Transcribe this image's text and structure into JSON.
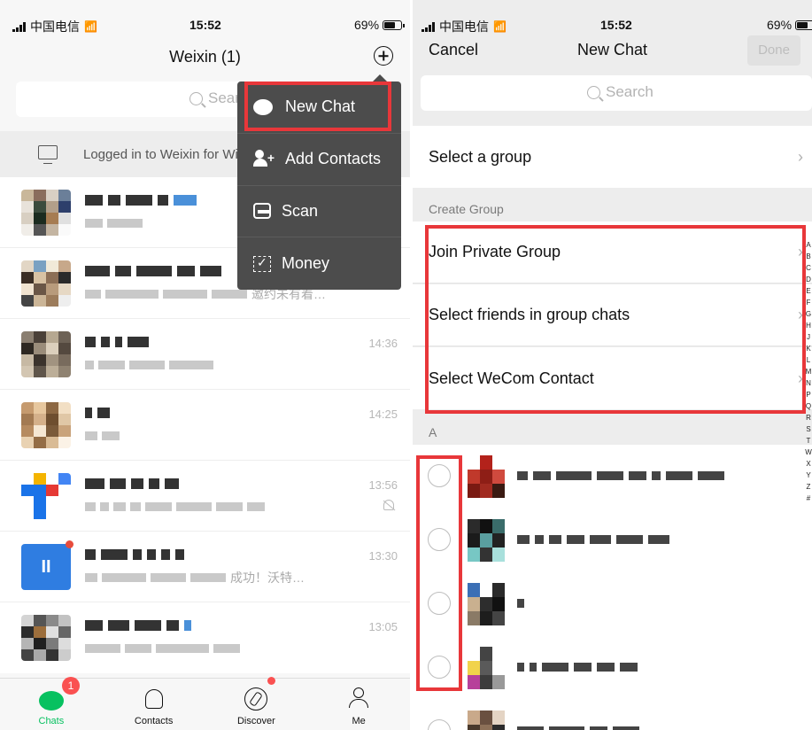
{
  "left": {
    "status": {
      "carrier": "中国电信",
      "time": "15:52",
      "battery": "69%"
    },
    "header": {
      "title": "Weixin (1)"
    },
    "search": {
      "placeholder": "Search"
    },
    "logged_in": "Logged in to Weixin for Windows",
    "chats": [
      {
        "time": ""
      },
      {
        "time": "",
        "preview_tail": "邀约未有着…"
      },
      {
        "time": "14:36"
      },
      {
        "time": "14:25"
      },
      {
        "time": "13:56"
      },
      {
        "time": "13:30",
        "preview_tail": "成功！沃特…"
      },
      {
        "time": "13:05"
      }
    ],
    "menu": [
      {
        "label": "New Chat",
        "icon": "chat-bubble-icon"
      },
      {
        "label": "Add Contacts",
        "icon": "add-contact-icon"
      },
      {
        "label": "Scan",
        "icon": "scan-icon"
      },
      {
        "label": "Money",
        "icon": "money-icon"
      }
    ],
    "tabs": [
      {
        "label": "Chats",
        "badge": "1"
      },
      {
        "label": "Contacts"
      },
      {
        "label": "Discover"
      },
      {
        "label": "Me"
      }
    ]
  },
  "right": {
    "status": {
      "carrier": "中国电信",
      "time": "15:52",
      "battery": "69%"
    },
    "header": {
      "cancel": "Cancel",
      "title": "New Chat",
      "done": "Done"
    },
    "search": {
      "placeholder": "Search"
    },
    "select_group": "Select a group",
    "create_group_label": "Create Group",
    "options": [
      "Join Private Group",
      "Select friends in group chats",
      "Select WeCom Contact"
    ],
    "section_letter": "A",
    "index_letters": [
      "A",
      "B",
      "C",
      "D",
      "E",
      "F",
      "G",
      "H",
      "J",
      "K",
      "L",
      "M",
      "N",
      "P",
      "Q",
      "R",
      "S",
      "T",
      "W",
      "X",
      "Y",
      "Z",
      "#"
    ]
  },
  "colors": {
    "accent_green": "#07c160",
    "highlight_red": "#e8373a",
    "badge_red": "#fa5151",
    "menu_bg": "#4c4c4c"
  }
}
